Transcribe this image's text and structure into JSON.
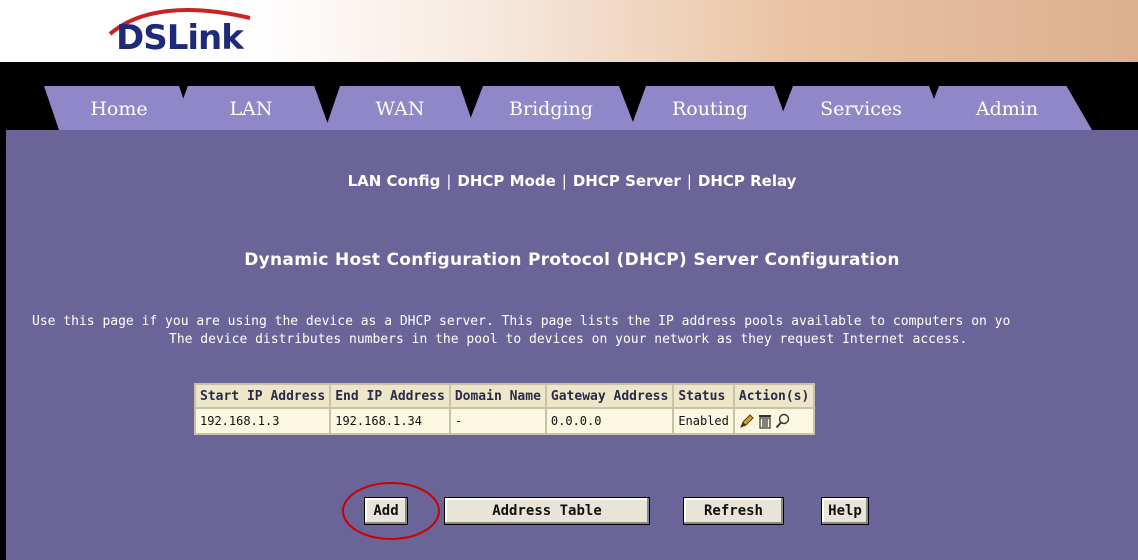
{
  "header": {
    "logo_text": "DSLink"
  },
  "tabs": [
    {
      "label": "Home"
    },
    {
      "label": "LAN"
    },
    {
      "label": "WAN"
    },
    {
      "label": "Bridging"
    },
    {
      "label": "Routing"
    },
    {
      "label": "Services"
    },
    {
      "label": "Admin"
    }
  ],
  "subnav": {
    "items": [
      "LAN Config",
      "DHCP Mode",
      "DHCP Server",
      "DHCP Relay"
    ],
    "separator": "|"
  },
  "main": {
    "title": "Dynamic Host Configuration Protocol (DHCP) Server Configuration",
    "description_line1": "Use this page if you are using the device as a DHCP server. This page lists the IP address pools available to computers on yo",
    "description_line2": "The device distributes numbers in the pool to devices on your network as they request Internet access."
  },
  "table": {
    "headers": [
      "Start IP Address",
      "End IP Address",
      "Domain Name",
      "Gateway Address",
      "Status",
      "Action(s)"
    ],
    "rows": [
      [
        "192.168.1.3",
        "192.168.1.34",
        "-",
        "0.0.0.0",
        "Enabled"
      ]
    ],
    "action_icons": [
      "edit-pencil-icon",
      "delete-trash-icon",
      "view-magnifier-icon"
    ]
  },
  "buttons": {
    "add": "Add",
    "address_table": "Address Table",
    "refresh": "Refresh",
    "help": "Help"
  },
  "colors": {
    "panel": "#6a6499",
    "tab": "#8f87c8",
    "highlight_circle": "#cc0000"
  }
}
